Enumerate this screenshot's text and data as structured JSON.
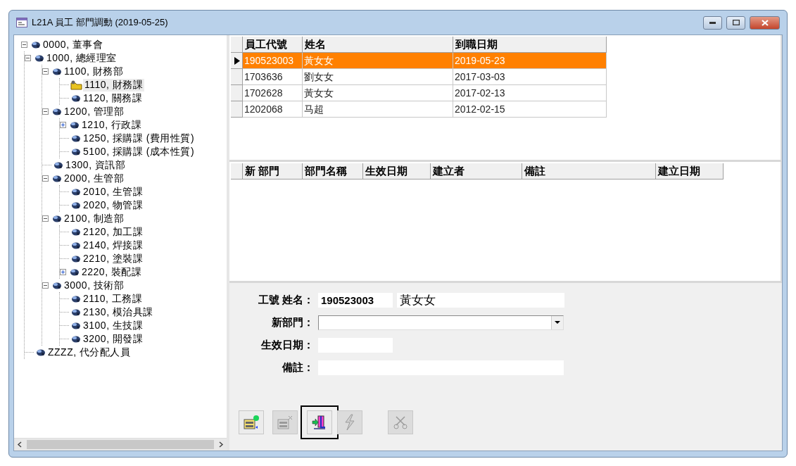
{
  "window": {
    "title": "L21A 員工 部門調動 (2019-05-25)"
  },
  "tree": [
    {
      "label": "0000, 董事會",
      "expanded": true,
      "selected": false,
      "children": [
        {
          "label": "1000, 總經理室",
          "expanded": true,
          "selected": false,
          "children": [
            {
              "label": "1100, 財務部",
              "expanded": true,
              "selected": false,
              "children": [
                {
                  "label": "1110, 財務課",
                  "selected": true
                },
                {
                  "label": "1120, 關務課",
                  "selected": false
                }
              ]
            },
            {
              "label": "1200, 管理部",
              "expanded": true,
              "selected": false,
              "children": [
                {
                  "label": "1210, 行政課",
                  "expanded": false,
                  "selected": false
                },
                {
                  "label": "1250, 採購課 (費用性質)",
                  "selected": false
                },
                {
                  "label": "5100, 採購課 (成本性質)",
                  "selected": false
                }
              ]
            },
            {
              "label": "1300, 資訊部",
              "selected": false
            },
            {
              "label": "2000, 生管部",
              "expanded": true,
              "selected": false,
              "children": [
                {
                  "label": "2010, 生管課",
                  "selected": false
                },
                {
                  "label": "2020, 物管課",
                  "selected": false
                }
              ]
            },
            {
              "label": "2100, 制造部",
              "expanded": true,
              "selected": false,
              "children": [
                {
                  "label": "2120, 加工課",
                  "selected": false
                },
                {
                  "label": "2140, 焊接課",
                  "selected": false
                },
                {
                  "label": "2210, 塗裝課",
                  "selected": false
                },
                {
                  "label": "2220, 裝配課",
                  "expanded": false,
                  "selected": false
                }
              ]
            },
            {
              "label": "3000, 技術部",
              "expanded": true,
              "selected": false,
              "children": [
                {
                  "label": "2110, 工務課",
                  "selected": false
                },
                {
                  "label": "2130, 模治具課",
                  "selected": false
                },
                {
                  "label": "3100, 生技課",
                  "selected": false
                },
                {
                  "label": "3200, 開發課",
                  "selected": false
                }
              ]
            }
          ]
        },
        {
          "label": "ZZZZ, 代分配人員",
          "selected": false
        }
      ]
    }
  ],
  "employees": {
    "columns": [
      "員工代號",
      "姓名",
      "到職日期"
    ],
    "rows": [
      {
        "cells": [
          "190523003",
          "黃女女",
          "2019-05-23"
        ],
        "selected": true
      },
      {
        "cells": [
          "1703636",
          "劉女女",
          "2017-03-03"
        ],
        "selected": false
      },
      {
        "cells": [
          "1702628",
          "黃女女",
          "2017-02-13"
        ],
        "selected": false
      },
      {
        "cells": [
          "1202068",
          "马超",
          "2012-02-15"
        ],
        "selected": false
      }
    ]
  },
  "transfers": {
    "columns": [
      "新 部門",
      "部門名稱",
      "生效日期",
      "建立者",
      "備註",
      "建立日期"
    ]
  },
  "form": {
    "id_name_label": "工號 姓名：",
    "id_value": "190523003",
    "name_value": "黃女女",
    "department_label": "新部門：",
    "date_label": "生效日期：",
    "note_label": "備註："
  },
  "buttons": [
    {
      "kind": "add",
      "disabled": false,
      "focused": false
    },
    {
      "kind": "delete",
      "disabled": true,
      "focused": false
    },
    {
      "kind": "transfer",
      "disabled": false,
      "focused": true
    },
    {
      "kind": "execute",
      "disabled": true,
      "focused": false
    },
    {
      "kind": "cut",
      "disabled": true,
      "focused": false
    }
  ]
}
